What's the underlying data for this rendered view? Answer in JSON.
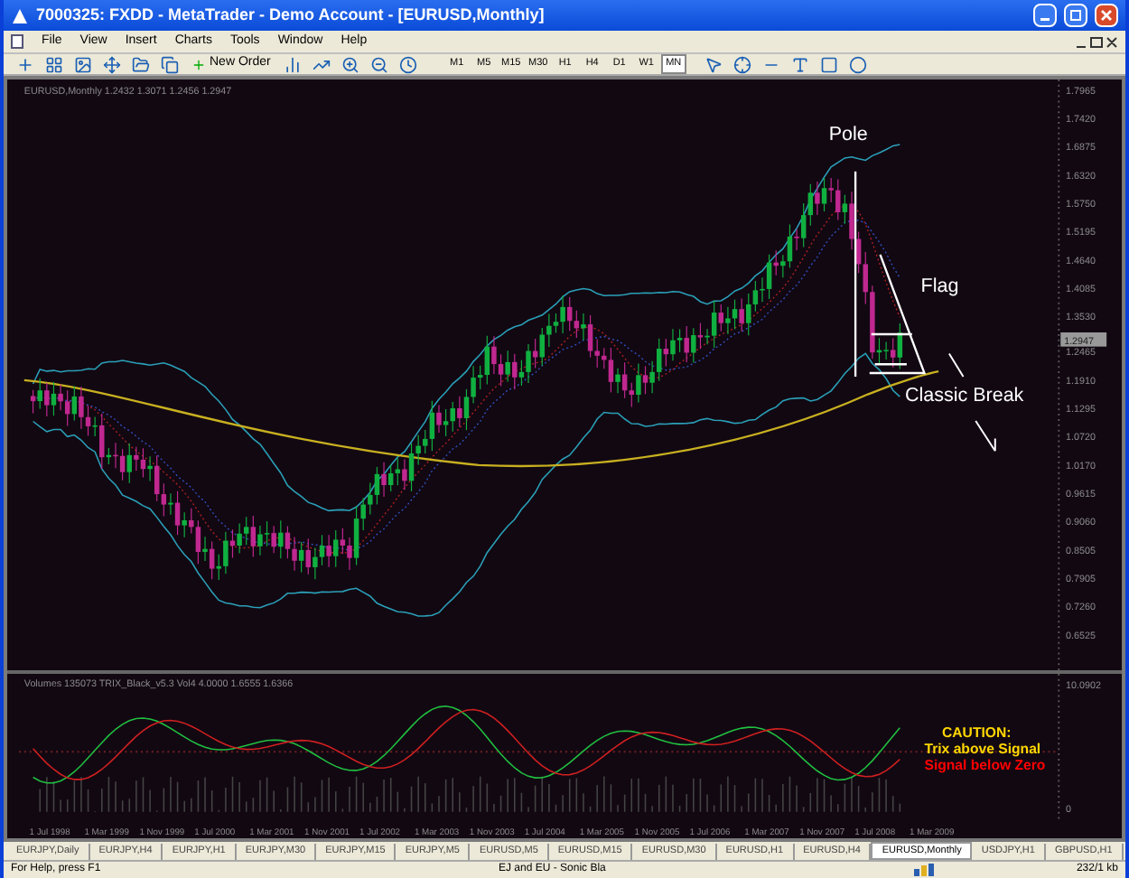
{
  "window": {
    "title": "7000325: FXDD - MetaTrader - Demo Account - [EURUSD,Monthly]"
  },
  "menu": [
    "File",
    "View",
    "Insert",
    "Charts",
    "Tools",
    "Window",
    "Help"
  ],
  "toolbar": {
    "new_order": "New Order",
    "timeframes": [
      {
        "label": "M1",
        "selected": false
      },
      {
        "label": "M5",
        "selected": false
      },
      {
        "label": "M15",
        "selected": false
      },
      {
        "label": "M30",
        "selected": false
      },
      {
        "label": "H1",
        "selected": false
      },
      {
        "label": "H4",
        "selected": false
      },
      {
        "label": "D1",
        "selected": false
      },
      {
        "label": "W1",
        "selected": false
      },
      {
        "label": "MN",
        "selected": true
      }
    ]
  },
  "chart": {
    "header": "EURUSD,Monthly  1.2432 1.3071 1.2456 1.2947",
    "price_axis": [
      "1.7965",
      "1.7420",
      "1.6875",
      "1.6320",
      "1.5750",
      "1.5195",
      "1.4640",
      "1.4085",
      "1.3530",
      "1.2465",
      "1.1910",
      "1.1295",
      "1.0720",
      "1.0170",
      "0.9615",
      "0.9060",
      "0.8505",
      "0.7905",
      "0.7260",
      "0.6525"
    ],
    "current_price": "1.2947",
    "annotations": {
      "pole": "Pole",
      "flag": "Flag",
      "break": "Classic Break"
    }
  },
  "indicator": {
    "header": "Volumes 135073   TRIX_Black_v5.3 Vol4 4.0000 1.6555 1.6366",
    "axis": [
      "10.0902",
      "0"
    ],
    "notes": [
      {
        "text": "CAUTION:",
        "color": "#ffd700"
      },
      {
        "text": "Trix above Signal",
        "color": "#ffd700"
      },
      {
        "text": "Signal below Zero",
        "color": "#ff0000"
      }
    ]
  },
  "time_axis": [
    "1 Jul 1998",
    "1 Mar 1999",
    "1 Nov 1999",
    "1 Jul 2000",
    "1 Mar 2001",
    "1 Nov 2001",
    "1 Jul 2002",
    "1 Mar 2003",
    "1 Nov 2003",
    "1 Jul 2004",
    "1 Mar 2005",
    "1 Nov 2005",
    "1 Jul 2006",
    "1 Mar 2007",
    "1 Nov 2007",
    "1 Jul 2008",
    "1 Mar 2009"
  ],
  "tabs": [
    {
      "label": "EURJPY,Daily",
      "selected": false
    },
    {
      "label": "EURJPY,H4",
      "selected": false
    },
    {
      "label": "EURJPY,H1",
      "selected": false
    },
    {
      "label": "EURJPY,M30",
      "selected": false
    },
    {
      "label": "EURJPY,M15",
      "selected": false
    },
    {
      "label": "EURJPY,M5",
      "selected": false
    },
    {
      "label": "EURUSD,M5",
      "selected": false
    },
    {
      "label": "EURUSD,M15",
      "selected": false
    },
    {
      "label": "EURUSD,M30",
      "selected": false
    },
    {
      "label": "EURUSD,H1",
      "selected": false
    },
    {
      "label": "EURUSD,H4",
      "selected": false
    },
    {
      "label": "EURUSD,Monthly",
      "selected": true
    },
    {
      "label": "USDJPY,H1",
      "selected": false
    },
    {
      "label": "GBPUSD,H1",
      "selected": false
    }
  ],
  "status_bar": [
    "For Help, press F1",
    "EJ and EU - Sonic Bla",
    "232/1 kb"
  ]
}
